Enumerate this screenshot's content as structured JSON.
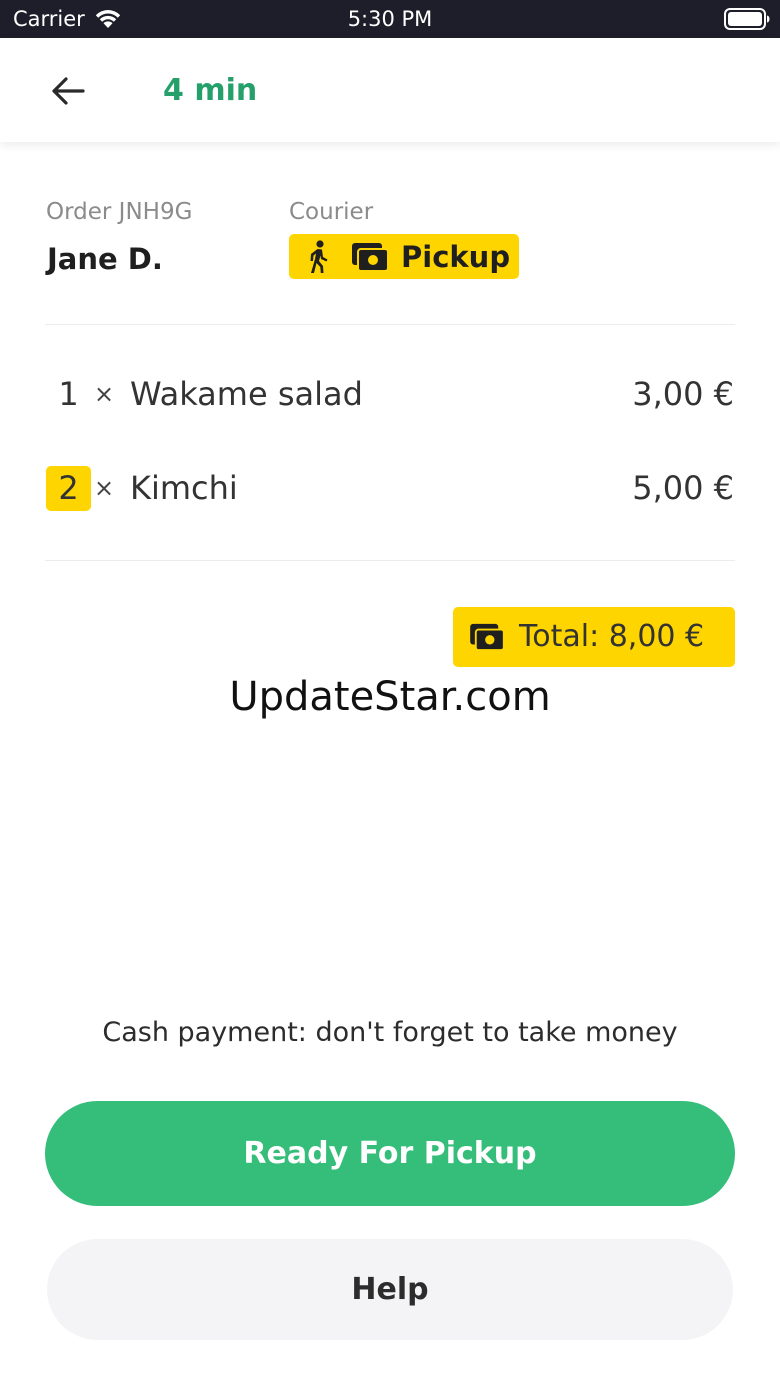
{
  "status_bar": {
    "carrier": "Carrier",
    "time": "5:30 PM",
    "wifi_icon": "wifi-icon",
    "battery_icon": "battery-full-icon"
  },
  "header": {
    "back_icon": "arrow-left-icon",
    "eta": "4 min",
    "eta_color": "#26a06b"
  },
  "order": {
    "order_label": "Order JNH9G",
    "customer_name": "Jane D.",
    "courier_label": "Courier",
    "courier_badge": {
      "icons": [
        "walking-person-icon",
        "cash-icon"
      ],
      "text": "Pickup",
      "color": "#ffd500"
    }
  },
  "items": [
    {
      "qty": "1",
      "times": "×",
      "name": "Wakame salad",
      "price": "3,00 €",
      "qty_highlighted": false
    },
    {
      "qty": "2",
      "times": "×",
      "name": "Kimchi",
      "price": "5,00 €",
      "qty_highlighted": true
    }
  ],
  "total": {
    "icon": "cash-icon",
    "text": "Total: 8,00 €"
  },
  "watermark": "UpdateStar.com",
  "cash_note": "Cash payment: don't forget to take money",
  "actions": {
    "primary_label": "Ready For Pickup",
    "primary_color": "#35bd7a",
    "secondary_label": "Help",
    "secondary_color": "#f4f4f6"
  }
}
